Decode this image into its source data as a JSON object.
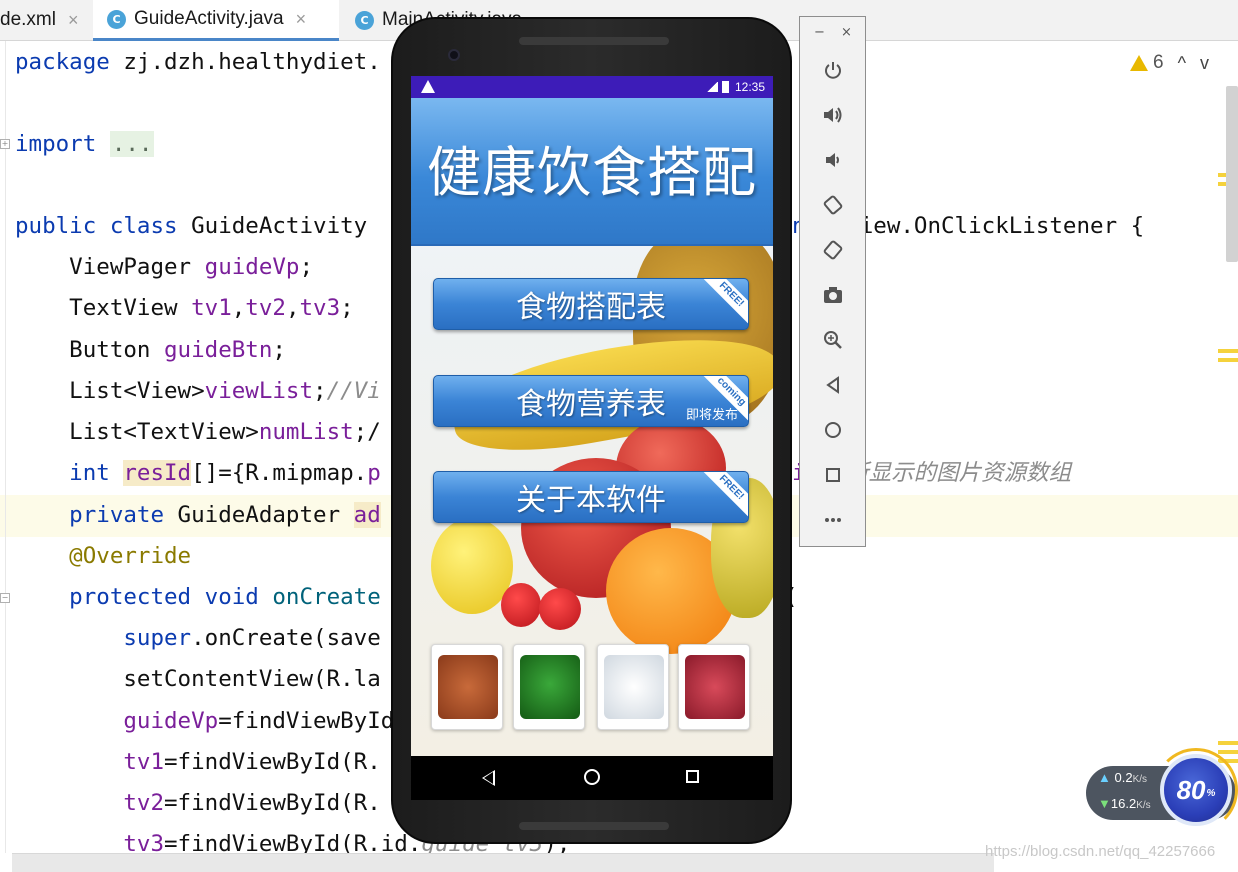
{
  "ide": {
    "tabs": [
      {
        "label": "de.xml",
        "close": "×"
      },
      {
        "label": "GuideActivity.java",
        "close": "×",
        "icon": "C"
      },
      {
        "label": "MainActivity.java",
        "icon": "C"
      }
    ],
    "warning_count": "6",
    "nav_up": "^",
    "nav_down": "v",
    "code": {
      "l1_kw": "package",
      "l1_rest": " zj.dzh.healthydiet.",
      "l2_kw": "import",
      "l2_fold": "...",
      "l3_a": "public class",
      "l3_b": " GuideActivity ",
      "l3_c": "nts",
      "l3_d": " View.OnClickListener {",
      "l4_a": "    ViewPager ",
      "l4_b": "guideVp",
      "l4_c": ";",
      "l5_a": "    TextView ",
      "l5_b": "tv1",
      "l5_c": ",",
      "l5_d": "tv2",
      "l5_e": ",",
      "l5_f": "tv3",
      "l5_g": ";",
      "l6_a": "    Button ",
      "l6_b": "guideBtn",
      "l6_c": ";",
      "l7_a": "    List<View>",
      "l7_b": "viewList",
      "l7_c": ";",
      "l7_d": "//Vi",
      "l8_a": "    List<TextView>",
      "l8_b": "numList",
      "l8_c": ";/",
      "l9_a": "    int",
      "l9_b": " ",
      "l9_c": "resId",
      "l9_d": "[]={R.mipmap.",
      "l9_e": "p",
      "l9_f": "i",
      "l9_g": "//所显示的图片资源数组",
      "l10_a": "    private",
      "l10_b": " GuideAdapter ",
      "l10_c": "ad",
      "l11": "    @Override",
      "l12_a": "    protected void",
      "l12_b": " onCreate",
      "l12_c": "(",
      "l13_a": "        super",
      "l13_b": ".onCreate(save",
      "l14": "        setContentView(R.la",
      "l15_a": "        guideVp",
      "l15_b": "=findViewById(R.",
      "l16_a": "        tv1",
      "l16_b": "=findViewById(R.",
      "l17_a": "        tv2",
      "l17_b": "=findViewById(R.",
      "l18_a": "        tv3",
      "l18_b": "=findViewById(R.id.",
      "l18_c": "guide_tv3",
      "l18_d": ");"
    },
    "watermark": "https://blog.csdn.net/qq_42257666"
  },
  "phone": {
    "status_time": "12:35",
    "app_title": "健康饮食搭配",
    "buttons": [
      {
        "label": "食物搭配表",
        "ribbon": "FREE!"
      },
      {
        "label": "食物营养表",
        "ribbon": "coming",
        "sub": "即将发布"
      },
      {
        "label": "关于本软件",
        "ribbon": "FREE!"
      }
    ],
    "thumbs": [
      "crab",
      "spinach",
      "eggs",
      "beef"
    ]
  },
  "emulator_toolbar": {
    "minimize": "−",
    "close": "×",
    "icons": [
      "power-icon",
      "volume-up-icon",
      "volume-down-icon",
      "rotate-left-icon",
      "rotate-right-icon",
      "camera-icon",
      "zoom-icon",
      "back-icon",
      "home-icon",
      "overview-icon",
      "more-icon"
    ]
  },
  "speed_widget": {
    "upload": "0.2",
    "download": "16.2",
    "unit": "K/s",
    "percent": "80",
    "percent_sign": "%"
  },
  "colors": {
    "status_bar": "#3d1cb8",
    "banner": "#3a88d8",
    "keyword": "#0b3bb0",
    "field": "#7a1f9a"
  }
}
